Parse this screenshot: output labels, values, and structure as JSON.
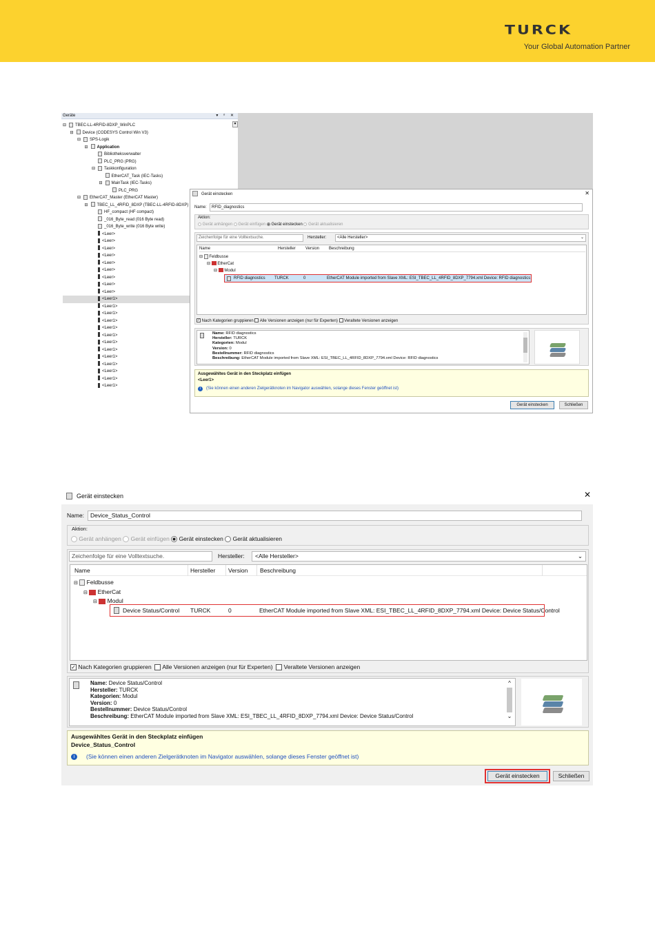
{
  "brand": {
    "logo": "TURCK",
    "tagline": "Your Global Automation Partner"
  },
  "devices": {
    "title": "Geräte",
    "controls": "▾ ᵒ ✕",
    "tree": [
      {
        "t": "TBEC-LL-4RFID-8DXP_WinPLC",
        "ind": 0,
        "ico": "project-icon",
        "ex": "⊟"
      },
      {
        "t": "Device (CODESYS Control Win V3)",
        "ind": 1,
        "ico": "device-icon",
        "ex": "⊟"
      },
      {
        "t": "SPS-Logik",
        "ind": 2,
        "ico": "plc-logic-icon",
        "ex": "⊟"
      },
      {
        "t": "Application",
        "ind": 3,
        "ico": "application-icon",
        "ex": "⊟",
        "bold": true
      },
      {
        "t": "Bibliotheksverwalter",
        "ind": 4,
        "ico": "library-icon"
      },
      {
        "t": "PLC_PRG (PRG)",
        "ind": 4,
        "ico": "program-icon"
      },
      {
        "t": "Taskkonfiguration",
        "ind": 4,
        "ico": "task-config-icon",
        "ex": "⊟"
      },
      {
        "t": "EtherCAT_Task (IEC-Tasks)",
        "ind": 5,
        "ico": "task-icon"
      },
      {
        "t": "MainTask (IEC-Tasks)",
        "ind": 5,
        "ico": "task-icon",
        "ex": "⊟"
      },
      {
        "t": "PLC_PRG",
        "ind": 6,
        "ico": "program-icon"
      },
      {
        "t": "EtherCAT_Master (EtherCAT Master)",
        "ind": 2,
        "ico": "ethercat-master-icon",
        "ex": "⊟"
      },
      {
        "t": "TBEC_LL_4RFID_8DXP (TBEC-LL-4RFID-8DXP)",
        "ind": 3,
        "ico": "ethercat-slave-icon",
        "ex": "⊟"
      },
      {
        "t": "HF_compact (HF compact)",
        "ind": 4,
        "ico": "module-icon"
      },
      {
        "t": "_016_Byte_read (016 Byte read)",
        "ind": 4,
        "ico": "module-icon"
      },
      {
        "t": "_016_Byte_write (016 Byte write)",
        "ind": 4,
        "ico": "module-icon"
      },
      {
        "t": "<Leer>",
        "ind": 4,
        "ico": "slot-icon"
      },
      {
        "t": "<Leer>",
        "ind": 4,
        "ico": "slot-icon"
      },
      {
        "t": "<Leer>",
        "ind": 4,
        "ico": "slot-icon"
      },
      {
        "t": "<Leer>",
        "ind": 4,
        "ico": "slot-icon"
      },
      {
        "t": "<Leer>",
        "ind": 4,
        "ico": "slot-icon"
      },
      {
        "t": "<Leer>",
        "ind": 4,
        "ico": "slot-icon"
      },
      {
        "t": "<Leer>",
        "ind": 4,
        "ico": "slot-icon"
      },
      {
        "t": "<Leer>",
        "ind": 4,
        "ico": "slot-icon"
      },
      {
        "t": "<Leer>",
        "ind": 4,
        "ico": "slot-icon"
      },
      {
        "t": "<Leer1>",
        "ind": 4,
        "ico": "slot-icon",
        "sel": true
      },
      {
        "t": "<Leer1>",
        "ind": 4,
        "ico": "slot-icon"
      },
      {
        "t": "<Leer1>",
        "ind": 4,
        "ico": "slot-icon"
      },
      {
        "t": "<Leer1>",
        "ind": 4,
        "ico": "slot-icon"
      },
      {
        "t": "<Leer1>",
        "ind": 4,
        "ico": "slot-icon"
      },
      {
        "t": "<Leer1>",
        "ind": 4,
        "ico": "slot-icon"
      },
      {
        "t": "<Leer1>",
        "ind": 4,
        "ico": "slot-icon"
      },
      {
        "t": "<Leer1>",
        "ind": 4,
        "ico": "slot-icon"
      },
      {
        "t": "<Leer1>",
        "ind": 4,
        "ico": "slot-icon"
      },
      {
        "t": "<Leer1>",
        "ind": 4,
        "ico": "slot-icon"
      },
      {
        "t": "<Leer1>",
        "ind": 4,
        "ico": "slot-icon"
      },
      {
        "t": "<Leer1>",
        "ind": 4,
        "ico": "slot-icon"
      },
      {
        "t": "<Leer1>",
        "ind": 4,
        "ico": "slot-icon"
      }
    ]
  },
  "dialog1": {
    "title": "Gerät einstecken",
    "name_label": "Name:",
    "name_value": "RFID_diagnostics",
    "aktion_label": "Aktion:",
    "opt_anhaengen": "Gerät anhängen",
    "opt_einfuegen": "Gerät einfügen",
    "opt_einstecken": "Gerät einstecken",
    "opt_aktualisieren": "Gerät aktualisieren",
    "search_placeholder": "Zeichenfolge für eine Volltextsuche.",
    "hersteller_label": "Hersteller:",
    "hersteller_value": "<Alle Hersteller>",
    "col_name": "Name",
    "col_hersteller": "Hersteller",
    "col_version": "Version",
    "col_beschreibung": "Beschreibung",
    "cat_feldbusse": "Feldbusse",
    "cat_ethercat": "EtherCat",
    "cat_modul": "Modul",
    "row_name": "RFID diagnostics",
    "row_hersteller": "TURCK",
    "row_version": "0",
    "row_desc": "EtherCAT Module imported from Slave XML: ESI_TBEC_LL_4RFID_8DXP_7794.xml Device: RFID diagnostics",
    "chk_gruppieren": "Nach Kategorien gruppieren",
    "chk_alle": "Alle Versionen anzeigen (nur für Experten)",
    "chk_veraltet": "Veraltete Versionen anzeigen",
    "info_name_l": "Name:",
    "info_name": "RFID diagnostics",
    "info_herst_l": "Hersteller:",
    "info_herst": "TURCK",
    "info_kat_l": "Kategorien:",
    "info_kat": "Modul",
    "info_ver_l": "Version:",
    "info_ver": "0",
    "info_best_l": "Bestellnummer:",
    "info_best": "RFID diagnostics",
    "info_desc_l": "Beschreibung:",
    "info_desc": "EtherCAT Module imported from Slave XML: ESI_TBEC_LL_4RFID_8DXP_7794.xml Device: RFID diagnostics",
    "slot_title": "Ausgewähltes Gerät in den Steckplatz einfügen",
    "slot_value": "<Leer1>",
    "hint": "(Sie können einen anderen Zielgerätknoten im Navigator auswählen, solange dieses Fenster geöffnet ist)",
    "btn_einstecken": "Gerät einstecken",
    "btn_schliessen": "Schließen"
  },
  "dialog2": {
    "title": "Gerät einstecken",
    "name_label": "Name:",
    "name_value": "Device_Status_Control",
    "aktion_label": "Aktion:",
    "opt_anhaengen": "Gerät anhängen",
    "opt_einfuegen": "Gerät einfügen",
    "opt_einstecken": "Gerät einstecken",
    "opt_aktualisieren": "Gerät aktualisieren",
    "search_placeholder": "Zeichenfolge für eine Volltextsuche.",
    "hersteller_label": "Hersteller:",
    "hersteller_value": "<Alle Hersteller>",
    "col_name": "Name",
    "col_hersteller": "Hersteller",
    "col_version": "Version",
    "col_beschreibung": "Beschreibung",
    "cat_feldbusse": "Feldbusse",
    "cat_ethercat": "EtherCat",
    "cat_modul": "Modul",
    "row_name": "Device Status/Control",
    "row_hersteller": "TURCK",
    "row_version": "0",
    "row_desc": "EtherCAT Module imported from Slave XML: ESI_TBEC_LL_4RFID_8DXP_7794.xml Device: Device Status/Control",
    "chk_gruppieren": "Nach Kategorien gruppieren",
    "chk_alle": "Alle Versionen anzeigen (nur für Experten)",
    "chk_veraltet": "Veraltete Versionen anzeigen",
    "info_name_l": "Name:",
    "info_name": "Device Status/Control",
    "info_herst_l": "Hersteller:",
    "info_herst": "TURCK",
    "info_kat_l": "Kategorien:",
    "info_kat": "Modul",
    "info_ver_l": "Version:",
    "info_ver": "0",
    "info_best_l": "Bestellnummer:",
    "info_best": "Device Status/Control",
    "info_desc_l": "Beschreibung:",
    "info_desc": "EtherCAT Module imported from Slave XML: ESI_TBEC_LL_4RFID_8DXP_7794.xml Device: Device Status/Control",
    "slot_title": "Ausgewähltes Gerät in den Steckplatz einfügen",
    "slot_value": "Device_Status_Control",
    "hint": "(Sie können einen anderen Zielgerätknoten im Navigator auswählen, solange dieses Fenster geöffnet ist)",
    "btn_einstecken": "Gerät einstecken",
    "btn_schliessen": "Schließen"
  }
}
